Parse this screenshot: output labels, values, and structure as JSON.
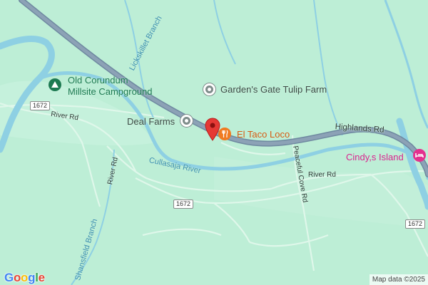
{
  "map": {
    "roads": {
      "highway_name": "Highlands Rd",
      "river_rd": "River Rd",
      "peaceful_cove_rd": "Peaceful Cove Rd",
      "route_shield": "1672"
    },
    "waterways": {
      "river_name": "Cullasaja River",
      "lickskillet": "Lickskillet Branch",
      "shansfield": "Shansfield Branch"
    },
    "places": {
      "campground_line1": "Old Corundum",
      "campground_line2": "Millsite Campground",
      "tulip_farm": "Garden's Gate Tulip Farm",
      "deal_farms": "Deal Farms",
      "taco": "El Taco Loco",
      "cindys": "Cindy,s Island"
    },
    "marker_color": "#e53935",
    "logo": "Google",
    "attribution": "Map data ©2025"
  }
}
